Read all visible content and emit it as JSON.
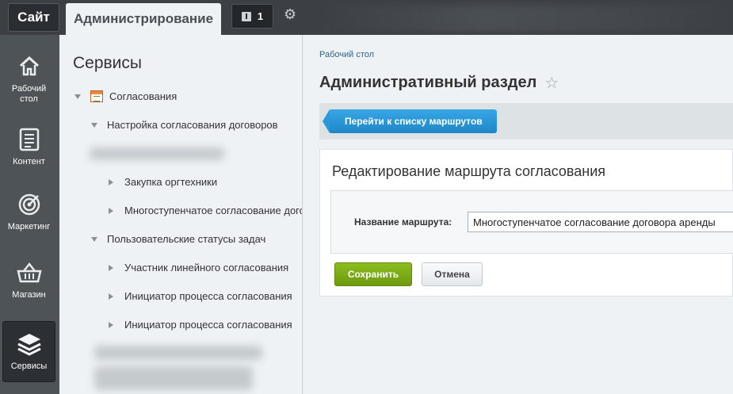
{
  "topbar": {
    "site_tab": "Сайт",
    "admin_tab": "Администрирование",
    "notifications_count": "1"
  },
  "leftnav": {
    "items": [
      {
        "label": "Рабочий стол",
        "icon": "home-icon"
      },
      {
        "label": "Контент",
        "icon": "document-icon"
      },
      {
        "label": "Маркетинг",
        "icon": "target-icon"
      },
      {
        "label": "Магазин",
        "icon": "basket-icon"
      },
      {
        "label": "Сервисы",
        "icon": "layers-icon",
        "active": true
      }
    ]
  },
  "sidebar": {
    "title": "Сервисы",
    "tree": [
      {
        "label": "Согласования",
        "level": 0,
        "expanded": true
      },
      {
        "label": "Настройка согласования договоров",
        "level": 1,
        "expanded": true
      },
      {
        "label": "Закупка оргтехники",
        "level": 2
      },
      {
        "label": "Многоступенчатое согласование договора аренды",
        "level": 2
      },
      {
        "label": "Пользовательские статусы задач",
        "level": 1,
        "expanded": true
      },
      {
        "label": "Участник линейного согласования",
        "level": 2
      },
      {
        "label": "Инициатор процесса согласования",
        "level": 2
      },
      {
        "label": "Инициатор процесса согласования",
        "level": 2
      }
    ]
  },
  "main": {
    "breadcrumb": "Рабочий стол",
    "title": "Административный раздел",
    "route_list_button": "Перейти к списку маршрутов",
    "card_title": "Редактирование маршрута согласования",
    "field_label": "Название маршрута:",
    "field_value": "Многоступенчатое согласование договора аренды",
    "save_button": "Сохранить",
    "cancel_button": "Отмена"
  },
  "colors": {
    "accent_blue": "#1e87c8",
    "save_green": "#7aab14",
    "topbar": "#3c4044",
    "leftnav": "#4d5357"
  }
}
